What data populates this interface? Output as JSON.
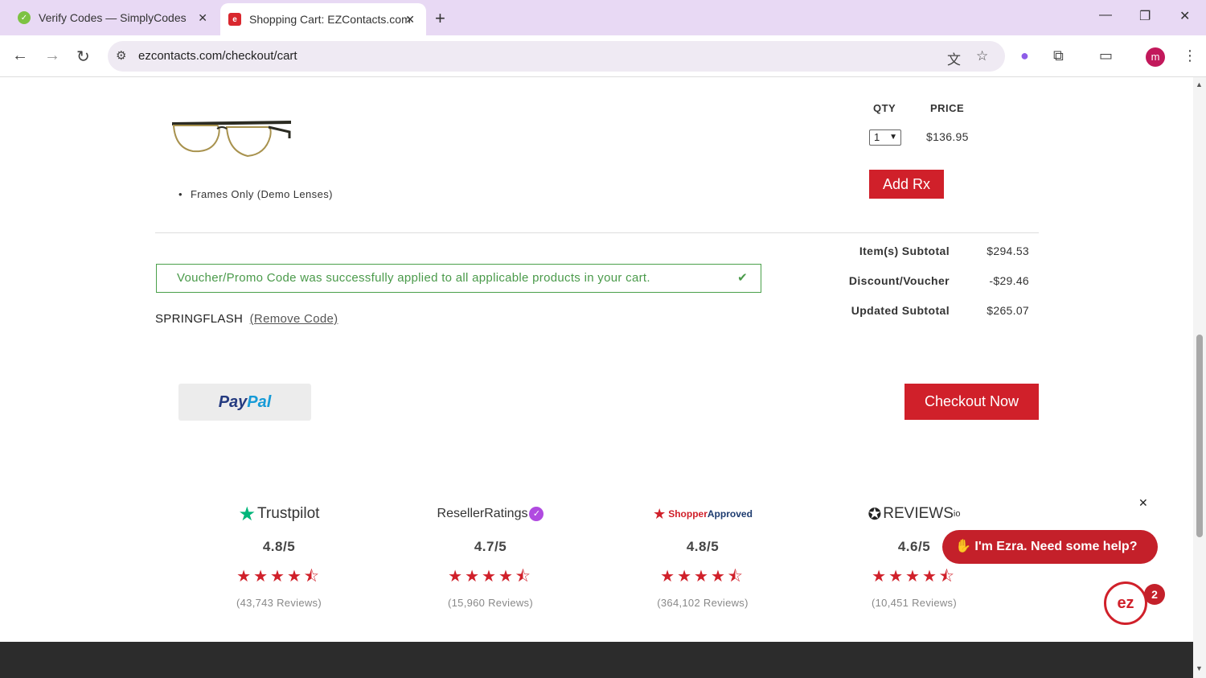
{
  "browser": {
    "tabs": [
      {
        "title": "Verify Codes — SimplyCodes",
        "active": false
      },
      {
        "title": "Shopping Cart: EZContacts.com",
        "active": true
      }
    ],
    "url": "ezcontacts.com/checkout/cart",
    "profile_initial": "m"
  },
  "cart": {
    "item_option": "Frames Only (Demo Lenses)",
    "qty_header": "QTY",
    "price_header": "PRICE",
    "qty_value": "1",
    "price": "$136.95",
    "add_rx_label": "Add Rx"
  },
  "voucher": {
    "message": "Voucher/Promo Code was successfully applied to all applicable products in your cart.",
    "code": "SPRINGFLASH",
    "remove_label": "(Remove Code)"
  },
  "summary": [
    {
      "label": "Item(s) Subtotal",
      "value": "$294.53"
    },
    {
      "label": "Discount/Voucher",
      "value": "-$29.46"
    },
    {
      "label": "Updated Subtotal",
      "value": "$265.07"
    }
  ],
  "buttons": {
    "paypal_pay": "Pay",
    "paypal_pal": "Pal",
    "checkout": "Checkout Now"
  },
  "ratings": [
    {
      "brand": "Trustpilot",
      "score": "4.8/5",
      "reviews": "(43,743 Reviews)"
    },
    {
      "brand": "ResellerRatings",
      "score": "4.7/5",
      "reviews": "(15,960 Reviews)"
    },
    {
      "brand_a": "Shopper",
      "brand_b": "Approved",
      "score": "4.8/5",
      "reviews": "(364,102 Reviews)"
    },
    {
      "brand": "REVIEWS",
      "brand_suffix": "io",
      "score": "4.6/5",
      "reviews": "(10,451 Reviews)"
    }
  ],
  "chat": {
    "message": "I'm Ezra. Need some help?",
    "badge": "2",
    "logo_text": "ez"
  },
  "colors": {
    "brand_red": "#d0202a",
    "success_green": "#4aa04a",
    "tab_bar": "#e8d9f4"
  }
}
